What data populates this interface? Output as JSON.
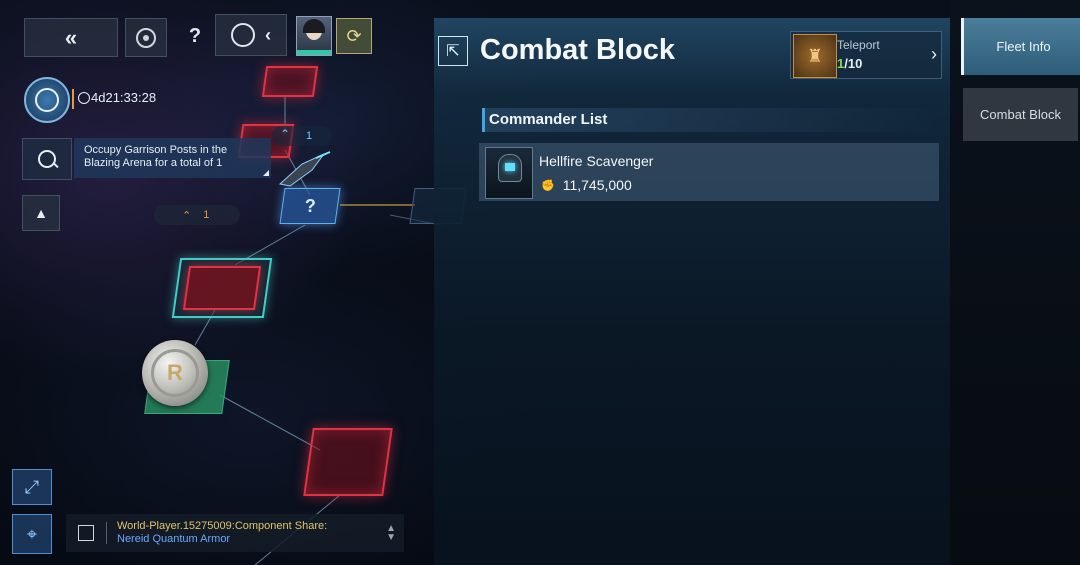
{
  "timer": "4d21:33:28",
  "quest": {
    "line1": "Occupy Garrison Posts in the",
    "line2": "Blazing Arena for a total of 1"
  },
  "map": {
    "question_node_count": "1",
    "fleet_badge_count": "1"
  },
  "chat": {
    "line1": "World-Player.15275009:Component Share:",
    "line2": "Nereid Quantum Armor"
  },
  "panel": {
    "title": "Combat Block",
    "teleport": {
      "label": "Teleport",
      "current": "1",
      "total": "/10"
    },
    "section_header": "Commander List",
    "commanders": [
      {
        "name": "Hellfire Scavenger",
        "power": "11,745,000"
      }
    ]
  },
  "side_tabs": [
    {
      "label": "Fleet Info"
    },
    {
      "label": "Combat Block"
    }
  ],
  "colors": {
    "accent_blue": "#3ea5e6",
    "tile_red": "#e03343",
    "tile_teal": "#3fd2c7",
    "teleport_count": "#7fdc5a",
    "badge_orange": "#e89a3a",
    "chat_gold": "#e0c46b",
    "chat_link": "#6aa8ff"
  }
}
